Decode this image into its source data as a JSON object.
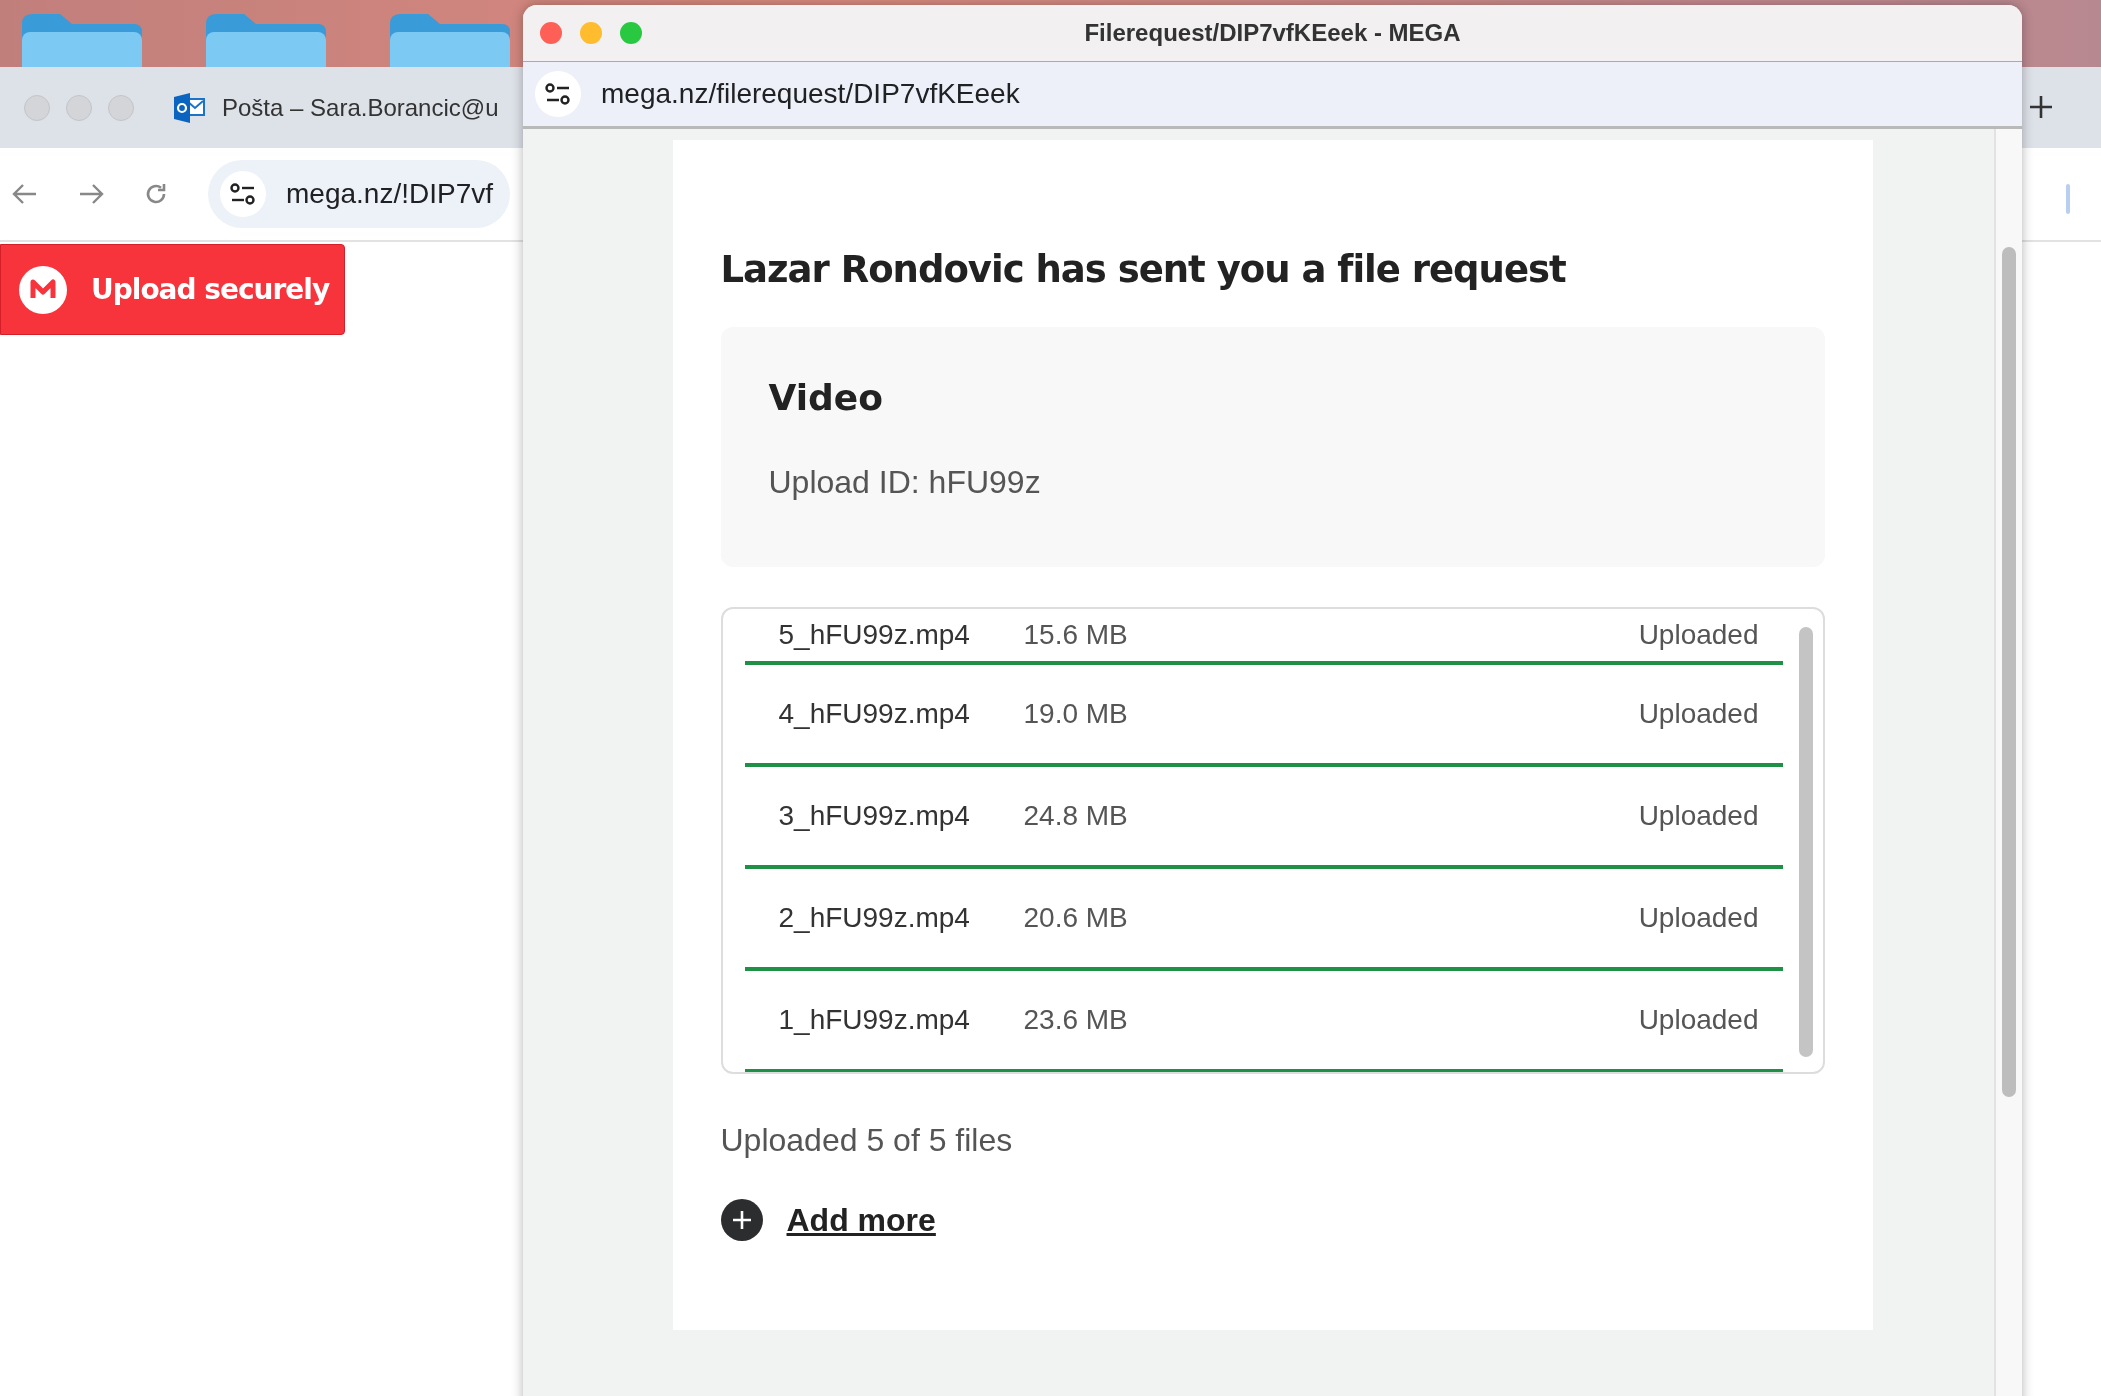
{
  "background_window": {
    "tab_title": "Pošta – Sara.Borancic@u",
    "address": "mega.nz/!DIP7vf",
    "upload_button": "Upload securely"
  },
  "popup": {
    "title": "Filerequest/DIP7vfKEeek - MEGA",
    "address": "mega.nz/filerequest/DIP7vfKEeek",
    "heading": "Lazar Rondovic has sent you a file request",
    "request": {
      "title": "Video",
      "upload_id": "Upload ID: hFU99z"
    },
    "files": [
      {
        "name": "5_hFU99z.mp4",
        "size": "15.6 MB",
        "status": "Uploaded"
      },
      {
        "name": "4_hFU99z.mp4",
        "size": "19.0 MB",
        "status": "Uploaded"
      },
      {
        "name": "3_hFU99z.mp4",
        "size": "24.8 MB",
        "status": "Uploaded"
      },
      {
        "name": "2_hFU99z.mp4",
        "size": "20.6 MB",
        "status": "Uploaded"
      },
      {
        "name": "1_hFU99z.mp4",
        "size": "23.6 MB",
        "status": "Uploaded"
      }
    ],
    "summary": "Uploaded 5 of 5 files",
    "add_more": "Add more"
  }
}
